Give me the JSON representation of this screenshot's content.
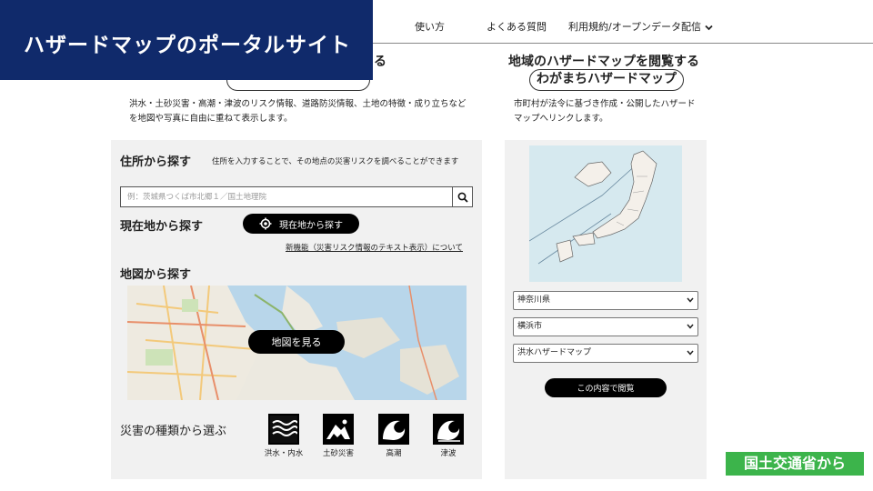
{
  "nav": {
    "items": [
      "使い方",
      "よくある質問",
      "利用規約/オープンデータ配信"
    ]
  },
  "banner": {
    "title": "ハザードマップのポータルサイト"
  },
  "left_header": {
    "title_tail": "る",
    "description": "洪水・土砂災害・高潮・津波のリスク情報、道路防災情報、土地の特徴・成り立ちなどを地図や写真に自由に重ねて表示します。"
  },
  "right_header": {
    "title": "地域のハザードマップを閲覧する",
    "pill": "わがまちハザードマップ",
    "description": "市町村が法令に基づき作成・公開したハザードマップへリンクします。"
  },
  "address_search": {
    "title": "住所から探す",
    "note": "住所を入力することで、その地点の災害リスクを調べることができます",
    "placeholder": "例：茨城県つくば市北郷１／国土地理院",
    "value": ""
  },
  "current_location": {
    "title": "現在地から探す",
    "button": "現在地から探す",
    "link": "新機能（災害リスク情報のテキスト表示）について"
  },
  "map_search": {
    "title": "地図から探す",
    "button": "地図を見る"
  },
  "disaster_types": {
    "title": "災害の種類から選ぶ",
    "items": [
      {
        "label": "洪水・内水",
        "icon": "flood-icon"
      },
      {
        "label": "土砂災害",
        "icon": "landslide-icon"
      },
      {
        "label": "高潮",
        "icon": "storm-surge-icon"
      },
      {
        "label": "津波",
        "icon": "tsunami-icon"
      }
    ]
  },
  "right_panel": {
    "prefecture": "神奈川県",
    "city": "横浜市",
    "map_type": "洪水ハザードマップ",
    "view_button": "この内容で閲覧"
  },
  "badge": {
    "text": "国土交通省から"
  },
  "colors": {
    "banner": "#102a6b",
    "badge": "#3cb44b",
    "panel": "#f1f1f1"
  }
}
